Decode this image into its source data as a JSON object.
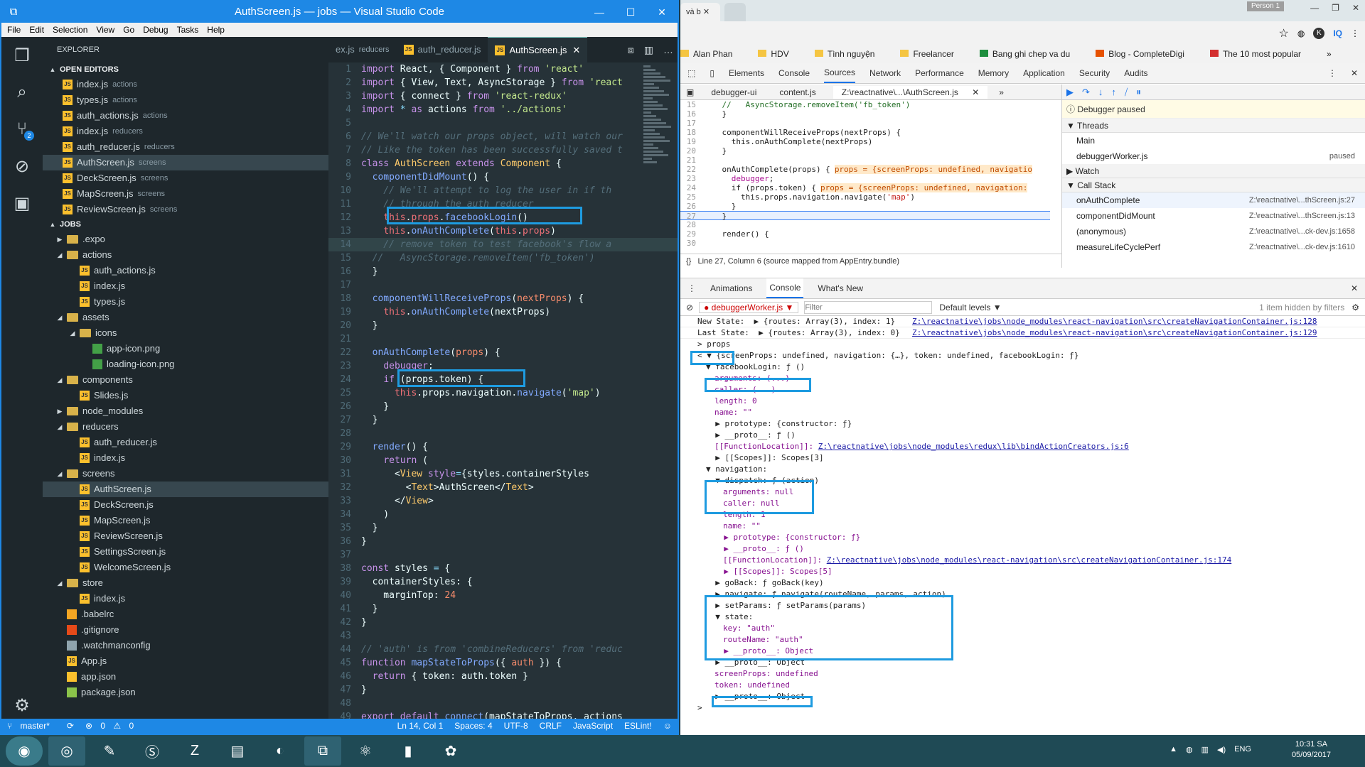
{
  "vscode": {
    "title": "AuthScreen.js — jobs — Visual Studio Code",
    "menu": [
      "File",
      "Edit",
      "Selection",
      "View",
      "Go",
      "Debug",
      "Tasks",
      "Help"
    ],
    "scm_badge": "2",
    "explorer_title": "EXPLORER",
    "open_editors_label": "OPEN EDITORS",
    "open_editors": [
      {
        "name": "index.js",
        "dir": "actions"
      },
      {
        "name": "types.js",
        "dir": "actions"
      },
      {
        "name": "auth_actions.js",
        "dir": "actions"
      },
      {
        "name": "index.js",
        "dir": "reducers"
      },
      {
        "name": "auth_reducer.js",
        "dir": "reducers"
      },
      {
        "name": "AuthScreen.js",
        "dir": "screens"
      },
      {
        "name": "DeckScreen.js",
        "dir": "screens"
      },
      {
        "name": "MapScreen.js",
        "dir": "screens"
      },
      {
        "name": "ReviewScreen.js",
        "dir": "screens"
      }
    ],
    "project_label": "JOBS",
    "tree": [
      {
        "name": ".expo",
        "type": "folder",
        "depth": 1,
        "open": false
      },
      {
        "name": "actions",
        "type": "folder",
        "depth": 1,
        "open": true
      },
      {
        "name": "auth_actions.js",
        "type": "js",
        "depth": 2
      },
      {
        "name": "index.js",
        "type": "js",
        "depth": 2
      },
      {
        "name": "types.js",
        "type": "js",
        "depth": 2
      },
      {
        "name": "assets",
        "type": "folder",
        "depth": 1,
        "open": true
      },
      {
        "name": "icons",
        "type": "folder",
        "depth": 2,
        "open": true
      },
      {
        "name": "app-icon.png",
        "type": "img",
        "depth": 3
      },
      {
        "name": "loading-icon.png",
        "type": "img",
        "depth": 3
      },
      {
        "name": "components",
        "type": "folder",
        "depth": 1,
        "open": true
      },
      {
        "name": "Slides.js",
        "type": "js",
        "depth": 2
      },
      {
        "name": "node_modules",
        "type": "folder",
        "depth": 1,
        "open": false
      },
      {
        "name": "reducers",
        "type": "folder",
        "depth": 1,
        "open": true
      },
      {
        "name": "auth_reducer.js",
        "type": "js",
        "depth": 2
      },
      {
        "name": "index.js",
        "type": "js",
        "depth": 2
      },
      {
        "name": "screens",
        "type": "folder",
        "depth": 1,
        "open": true
      },
      {
        "name": "AuthScreen.js",
        "type": "js",
        "depth": 2,
        "selected": true
      },
      {
        "name": "DeckScreen.js",
        "type": "js",
        "depth": 2
      },
      {
        "name": "MapScreen.js",
        "type": "js",
        "depth": 2
      },
      {
        "name": "ReviewScreen.js",
        "type": "js",
        "depth": 2
      },
      {
        "name": "SettingsScreen.js",
        "type": "js",
        "depth": 2
      },
      {
        "name": "WelcomeScreen.js",
        "type": "js",
        "depth": 2
      },
      {
        "name": "store",
        "type": "folder",
        "depth": 1,
        "open": true
      },
      {
        "name": "index.js",
        "type": "js",
        "depth": 2
      },
      {
        "name": ".babelrc",
        "type": "babel",
        "depth": 1
      },
      {
        "name": ".gitignore",
        "type": "git",
        "depth": 1
      },
      {
        "name": ".watchmanconfig",
        "type": "file",
        "depth": 1
      },
      {
        "name": "App.js",
        "type": "js",
        "depth": 1
      },
      {
        "name": "app.json",
        "type": "json",
        "depth": 1
      },
      {
        "name": "package.json",
        "type": "node",
        "depth": 1
      }
    ],
    "tabs": [
      {
        "name": "ex.js",
        "dir": "reducers",
        "active": false
      },
      {
        "name": "auth_reducer.js",
        "dir": "",
        "active": false
      },
      {
        "name": "AuthScreen.js",
        "dir": "",
        "active": true
      }
    ],
    "code": [
      [
        [
          "k",
          "import "
        ],
        [
          "ctext",
          "React, { Component } "
        ],
        [
          "k",
          "from "
        ],
        [
          "s",
          "'react'"
        ]
      ],
      [
        [
          "k",
          "import "
        ],
        [
          "ctext",
          "{ View, Text, AsyncStorage } "
        ],
        [
          "k",
          "from "
        ],
        [
          "s",
          "'react"
        ]
      ],
      [
        [
          "k",
          "import "
        ],
        [
          "ctext",
          "{ connect } "
        ],
        [
          "k",
          "from "
        ],
        [
          "s",
          "'react-redux'"
        ]
      ],
      [
        [
          "k",
          "import "
        ],
        [
          "o",
          "* "
        ],
        [
          "k",
          "as "
        ],
        [
          "ctext",
          "actions "
        ],
        [
          "k",
          "from "
        ],
        [
          "s",
          "'../actions'"
        ]
      ],
      [],
      [
        [
          "c",
          "// We'll watch our props object, will watch our"
        ]
      ],
      [
        [
          "c",
          "// Like the token has been successfully saved t"
        ]
      ],
      [
        [
          "k",
          "class "
        ],
        [
          "y",
          "AuthScreen "
        ],
        [
          "k",
          "extends "
        ],
        [
          "y",
          "Component "
        ],
        [
          "ctext",
          "{"
        ]
      ],
      [
        [
          "ctext",
          "  "
        ],
        [
          "f",
          "componentDidMount"
        ],
        [
          "ctext",
          "() {"
        ]
      ],
      [
        [
          "c",
          "    // We'll attempt to log the user in if th"
        ]
      ],
      [
        [
          "c",
          "    // through the auth_reducer"
        ]
      ],
      [
        [
          "ctext",
          "    "
        ],
        [
          "t",
          "this"
        ],
        [
          "ctext",
          "."
        ],
        [
          "t",
          "props"
        ],
        [
          "ctext",
          "."
        ],
        [
          "f",
          "facebookLogin"
        ],
        [
          "ctext",
          "()"
        ]
      ],
      [
        [
          "ctext",
          "    "
        ],
        [
          "t",
          "this"
        ],
        [
          "ctext",
          "."
        ],
        [
          "f",
          "onAuthComplete"
        ],
        [
          "ctext",
          "("
        ],
        [
          "t",
          "this"
        ],
        [
          "ctext",
          "."
        ],
        [
          "t",
          "props"
        ],
        [
          "ctext",
          ")"
        ]
      ],
      [
        [
          "c",
          "    // remove token to test facebook's flow a"
        ]
      ],
      [
        [
          "c",
          "  //   AsyncStorage.removeItem('fb_token')"
        ]
      ],
      [
        [
          "ctext",
          "  }"
        ]
      ],
      [],
      [
        [
          "ctext",
          "  "
        ],
        [
          "f",
          "componentWillReceiveProps"
        ],
        [
          "ctext",
          "("
        ],
        [
          "n",
          "nextProps"
        ],
        [
          "ctext",
          ") {"
        ]
      ],
      [
        [
          "ctext",
          "    "
        ],
        [
          "t",
          "this"
        ],
        [
          "ctext",
          "."
        ],
        [
          "f",
          "onAuthComplete"
        ],
        [
          "ctext",
          "(nextProps)"
        ]
      ],
      [
        [
          "ctext",
          "  }"
        ]
      ],
      [],
      [
        [
          "ctext",
          "  "
        ],
        [
          "f",
          "onAuthComplete"
        ],
        [
          "ctext",
          "("
        ],
        [
          "n",
          "props"
        ],
        [
          "ctext",
          ") {"
        ]
      ],
      [
        [
          "ctext",
          "    "
        ],
        [
          "k",
          "debugger"
        ],
        [
          "ctext",
          ";"
        ]
      ],
      [
        [
          "ctext",
          "    "
        ],
        [
          "k",
          "if "
        ],
        [
          "ctext",
          "(props.token) {"
        ]
      ],
      [
        [
          "ctext",
          "      "
        ],
        [
          "t",
          "this"
        ],
        [
          "ctext",
          ".props.navigation."
        ],
        [
          "f",
          "navigate"
        ],
        [
          "ctext",
          "("
        ],
        [
          "s",
          "'map'"
        ],
        [
          "ctext",
          ")"
        ]
      ],
      [
        [
          "ctext",
          "    }"
        ]
      ],
      [
        [
          "ctext",
          "  }"
        ]
      ],
      [],
      [
        [
          "ctext",
          "  "
        ],
        [
          "f",
          "render"
        ],
        [
          "ctext",
          "() {"
        ]
      ],
      [
        [
          "ctext",
          "    "
        ],
        [
          "k",
          "return "
        ],
        [
          "ctext",
          "("
        ]
      ],
      [
        [
          "ctext",
          "      <"
        ],
        [
          "y",
          "View "
        ],
        [
          "k",
          "style"
        ],
        [
          "o",
          "="
        ],
        [
          "ctext",
          "{styles.containerStyles"
        ]
      ],
      [
        [
          "ctext",
          "        <"
        ],
        [
          "y",
          "Text"
        ],
        [
          "ctext",
          ">AuthScreen</"
        ],
        [
          "y",
          "Text"
        ],
        [
          "ctext",
          ">"
        ]
      ],
      [
        [
          "ctext",
          "      </"
        ],
        [
          "y",
          "View"
        ],
        [
          "ctext",
          ">"
        ]
      ],
      [
        [
          "ctext",
          "    )"
        ]
      ],
      [
        [
          "ctext",
          "  }"
        ]
      ],
      [
        [
          "ctext",
          "}"
        ]
      ],
      [],
      [
        [
          "k",
          "const "
        ],
        [
          "ctext",
          "styles "
        ],
        [
          "o",
          "= "
        ],
        [
          "ctext",
          "{"
        ]
      ],
      [
        [
          "ctext",
          "  containerStyles: {"
        ]
      ],
      [
        [
          "ctext",
          "    marginTop: "
        ],
        [
          "n",
          "24"
        ]
      ],
      [
        [
          "ctext",
          "  }"
        ]
      ],
      [
        [
          "ctext",
          "}"
        ]
      ],
      [],
      [
        [
          "c",
          "// 'auth' is from 'combineReducers' from 'reduc"
        ]
      ],
      [
        [
          "k",
          "function "
        ],
        [
          "f",
          "mapStateToProps"
        ],
        [
          "ctext",
          "({ "
        ],
        [
          "n",
          "auth "
        ],
        [
          "ctext",
          "}) {"
        ]
      ],
      [
        [
          "ctext",
          "  "
        ],
        [
          "k",
          "return "
        ],
        [
          "ctext",
          "{ token: auth.token }"
        ]
      ],
      [
        [
          "ctext",
          "}"
        ]
      ],
      [],
      [
        [
          "k",
          "export default "
        ],
        [
          "f",
          "connect"
        ],
        [
          "ctext",
          "(mapStateToProps, actions"
        ]
      ]
    ],
    "status": {
      "branch": "master*",
      "errors": "0",
      "warnings": "0",
      "pos": "Ln 14, Col 1",
      "spaces": "Spaces: 4",
      "enc": "UTF-8",
      "eol": "CRLF",
      "lang": "JavaScript",
      "lint": "ESLint!"
    }
  },
  "chrome": {
    "tab1": "và b",
    "person": "Person 1",
    "bookmarks": [
      "Alan Phan",
      "HDV",
      "Tình nguyện",
      "Freelancer",
      "Bang ghi chep va du",
      "Blog - CompleteDigi",
      "The 10 most popular"
    ],
    "devtools_tabs": [
      "Elements",
      "Console",
      "Sources",
      "Network",
      "Performance",
      "Memory",
      "Application",
      "Security",
      "Audits"
    ],
    "source_tabs": [
      "debugger-ui",
      "content.js",
      "Z:\\reactnative\\...\\AuthScreen.js"
    ],
    "source_lines": [
      {
        "n": "15",
        "parts": [
          [
            "cm",
            "    //   AsyncStorage.removeItem('fb_token')"
          ]
        ]
      },
      {
        "n": "16",
        "parts": [
          [
            "",
            "    }"
          ]
        ]
      },
      {
        "n": "17",
        "parts": []
      },
      {
        "n": "18",
        "parts": [
          [
            "",
            "    componentWillReceiveProps(nextProps) {"
          ]
        ]
      },
      {
        "n": "19",
        "parts": [
          [
            "",
            "      this.onAuthComplete(nextProps)"
          ]
        ]
      },
      {
        "n": "20",
        "parts": [
          [
            "",
            "    }"
          ]
        ]
      },
      {
        "n": "21",
        "parts": []
      },
      {
        "n": "22",
        "parts": [
          [
            "",
            "    onAuthComplete(props) {"
          ]
        ],
        "inline": "props = {screenProps: undefined, navigatio"
      },
      {
        "n": "23",
        "parts": [
          [
            "kw",
            "      debugger"
          ],
          [
            "",
            ";"
          ]
        ]
      },
      {
        "n": "24",
        "parts": [
          [
            "",
            "      if (props.token) {"
          ]
        ],
        "inline": "props = {screenProps: undefined, navigation:"
      },
      {
        "n": "25",
        "parts": [
          [
            "",
            "        this.props.navigation.navigate("
          ],
          [
            "st",
            "'map'"
          ],
          [
            "",
            ")"
          ]
        ]
      },
      {
        "n": "26",
        "parts": [
          [
            "",
            "      }"
          ]
        ]
      },
      {
        "n": "27",
        "parts": [
          [
            "",
            "    }"
          ]
        ],
        "current": true
      },
      {
        "n": "28",
        "parts": []
      },
      {
        "n": "29",
        "parts": [
          [
            "",
            "    render() {"
          ]
        ]
      },
      {
        "n": "30",
        "parts": []
      }
    ],
    "source_status": "Line 27, Column 6  (source mapped from AppEntry.bundle)",
    "debugger_paused": "Debugger paused",
    "threads_label": "Threads",
    "threads": [
      {
        "name": "Main",
        "state": ""
      },
      {
        "name": "debuggerWorker.js",
        "state": "paused"
      }
    ],
    "watch_label": "Watch",
    "callstack_label": "Call Stack",
    "callstack": [
      {
        "fn": "onAuthComplete",
        "loc": "Z:\\reactnative\\...thScreen.js:27"
      },
      {
        "fn": "componentDidMount",
        "loc": "Z:\\reactnative\\...thScreen.js:13"
      },
      {
        "fn": "(anonymous)",
        "loc": "Z:\\reactnative\\...ck-dev.js:1658"
      },
      {
        "fn": "measureLifeCyclePerf",
        "loc": "Z:\\reactnative\\...ck-dev.js:1610"
      }
    ],
    "drawer_tabs": [
      "Animations",
      "Console",
      "What's New"
    ],
    "context": "debuggerWorker.js",
    "filter_placeholder": "Filter",
    "levels": "Default levels",
    "hidden": "1 item hidden by filters",
    "console": [
      {
        "i": 0,
        "t": "New State:  ▶ {routes: Array(3), index: 1}",
        "link": "Z:\\reactnative\\jobs\\node_modules\\react-navigation\\src\\createNavigationContainer.js:128"
      },
      {
        "i": 0,
        "t": "Last State:  ▶ {routes: Array(3), index: 0}",
        "link": "Z:\\reactnative\\jobs\\node_modules\\react-navigation\\src\\createNavigationContainer.js:129"
      },
      {
        "i": 0,
        "t": "> props"
      },
      {
        "i": 0,
        "t": "< ▼ {screenProps: undefined, navigation: {…}, token: undefined, facebookLogin: ƒ}"
      },
      {
        "i": 1,
        "t": "▼ facebookLogin: ƒ ()"
      },
      {
        "i": 2,
        "t": "arguments: (...)"
      },
      {
        "i": 2,
        "t": "caller: (...)"
      },
      {
        "i": 2,
        "t": "length: 0"
      },
      {
        "i": 2,
        "t": "name: \"\""
      },
      {
        "i": 1,
        "t": "  ▶ prototype: {constructor: ƒ}"
      },
      {
        "i": 1,
        "t": "  ▶ __proto__: ƒ ()"
      },
      {
        "i": 2,
        "t": "[[FunctionLocation]]: ",
        "link": "Z:\\reactnative\\jobs\\node_modules\\redux\\lib\\bindActionCreators.js:6"
      },
      {
        "i": 1,
        "t": "  ▶ [[Scopes]]: Scopes[3]"
      },
      {
        "i": 1,
        "t": "▼ navigation:"
      },
      {
        "i": 1,
        "t": "  ▼ dispatch: ƒ (action)"
      },
      {
        "i": 3,
        "t": "arguments: null"
      },
      {
        "i": 3,
        "t": "caller: null"
      },
      {
        "i": 3,
        "t": "length: 1"
      },
      {
        "i": 3,
        "t": "name: \"\""
      },
      {
        "i": 2,
        "t": "  ▶ prototype: {constructor: ƒ}"
      },
      {
        "i": 2,
        "t": "  ▶ __proto__: ƒ ()"
      },
      {
        "i": 3,
        "t": "[[FunctionLocation]]: ",
        "link": "Z:\\reactnative\\jobs\\node_modules\\react-navigation\\src\\createNavigationContainer.js:174"
      },
      {
        "i": 2,
        "t": "  ▶ [[Scopes]]: Scopes[5]"
      },
      {
        "i": 1,
        "t": "  ▶ goBack: ƒ goBack(key)"
      },
      {
        "i": 1,
        "t": "  ▶ navigate: ƒ navigate(routeName, params, action)"
      },
      {
        "i": 1,
        "t": "  ▶ setParams: ƒ setParams(params)"
      },
      {
        "i": 1,
        "t": "  ▼ state:"
      },
      {
        "i": 3,
        "t": "key: \"auth\""
      },
      {
        "i": 3,
        "t": "routeName: \"auth\""
      },
      {
        "i": 2,
        "t": "  ▶ __proto__: Object"
      },
      {
        "i": 1,
        "t": "  ▶ __proto__: Object"
      },
      {
        "i": 2,
        "t": "screenProps: undefined"
      },
      {
        "i": 2,
        "t": "token: undefined"
      },
      {
        "i": 1,
        "t": "  ▶ __proto__: Object"
      },
      {
        "i": 0,
        "t": ">"
      }
    ]
  },
  "taskbar": {
    "lang": "ENG",
    "time": "10:31 SA",
    "date": "05/09/2017"
  },
  "colors": {
    "accent": "#1e88e5",
    "highlight": "#1e9be0"
  }
}
